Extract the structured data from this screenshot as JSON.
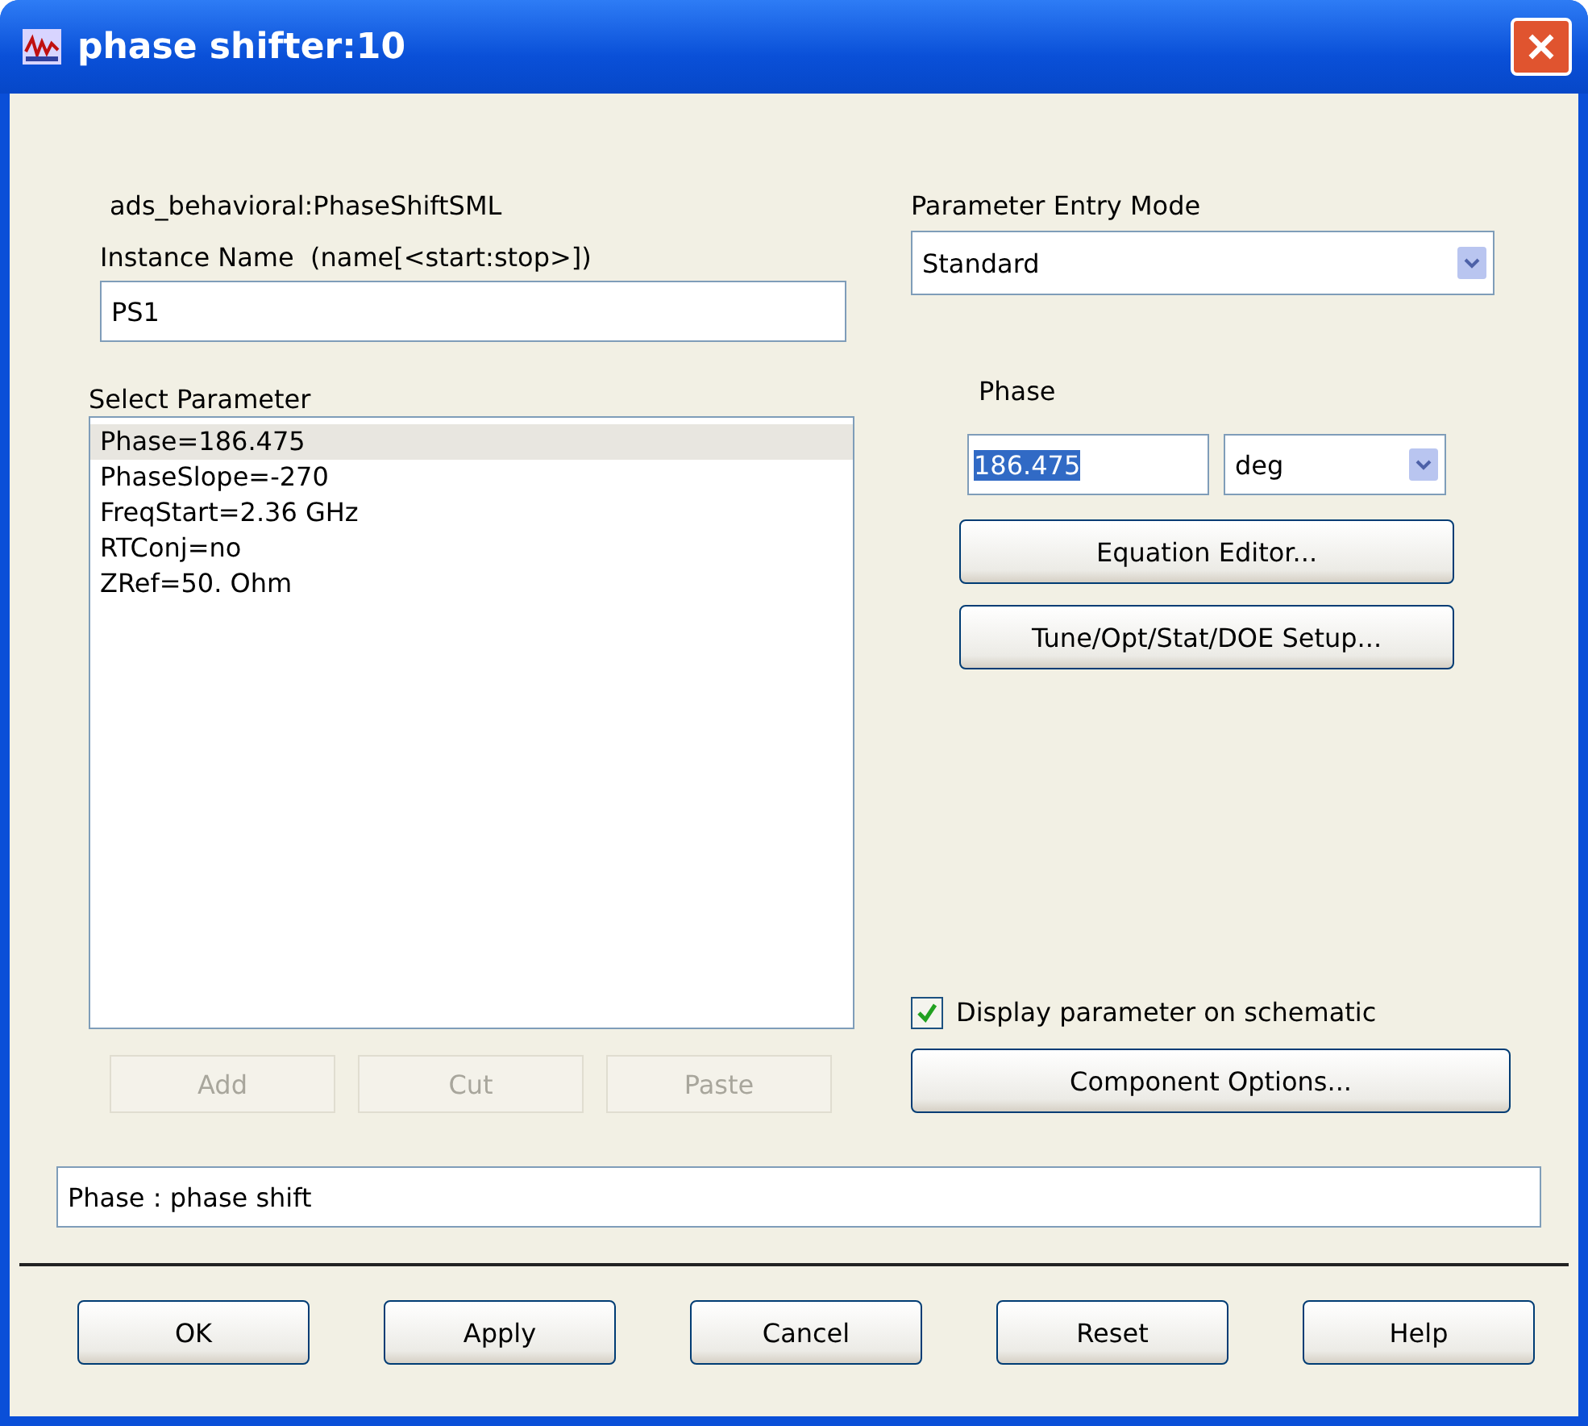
{
  "window": {
    "title": "phase shifter:10"
  },
  "component": "ads_behavioral:PhaseShiftSML",
  "instance": {
    "label": "Instance Name  (name[<start:stop>])",
    "value": "PS1"
  },
  "parameters": {
    "label": "Select Parameter",
    "items": [
      {
        "text": "Phase=186.475",
        "selected": true
      },
      {
        "text": "PhaseSlope=-270",
        "selected": false
      },
      {
        "text": "FreqStart=2.36 GHz",
        "selected": false
      },
      {
        "text": "RTConj=no",
        "selected": false
      },
      {
        "text": "ZRef=50. Ohm",
        "selected": false
      }
    ]
  },
  "list_buttons": [
    {
      "label": "Add",
      "disabled": true
    },
    {
      "label": "Cut",
      "disabled": true
    },
    {
      "label": "Paste",
      "disabled": true
    }
  ],
  "entry_mode": {
    "label": "Parameter Entry Mode",
    "value": "Standard"
  },
  "phase": {
    "label": "Phase",
    "value": "186.475",
    "value_selected": true,
    "unit": "deg"
  },
  "side_buttons": [
    "Equation Editor...",
    "Tune/Opt/Stat/DOE Setup..."
  ],
  "display_on_schematic": {
    "label": "Display parameter on schematic",
    "checked": true
  },
  "component_options_button": "Component Options...",
  "description": "Phase : phase shift",
  "buttons": [
    "OK",
    "Apply",
    "Cancel",
    "Reset",
    "Help"
  ]
}
